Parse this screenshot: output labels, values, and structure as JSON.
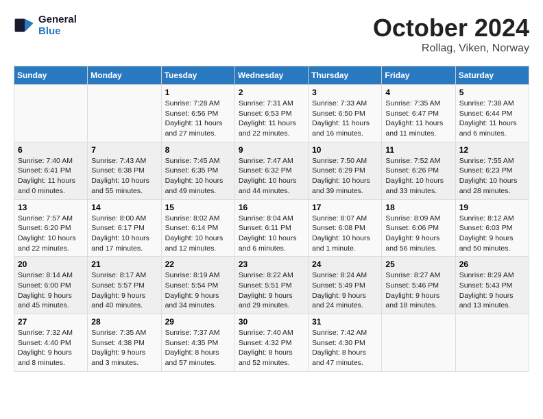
{
  "header": {
    "logo_line1": "General",
    "logo_line2": "Blue",
    "title": "October 2024",
    "subtitle": "Rollag, Viken, Norway"
  },
  "columns": [
    "Sunday",
    "Monday",
    "Tuesday",
    "Wednesday",
    "Thursday",
    "Friday",
    "Saturday"
  ],
  "weeks": [
    [
      {
        "day": "",
        "info": ""
      },
      {
        "day": "",
        "info": ""
      },
      {
        "day": "1",
        "info": "Sunrise: 7:28 AM\nSunset: 6:56 PM\nDaylight: 11 hours\nand 27 minutes."
      },
      {
        "day": "2",
        "info": "Sunrise: 7:31 AM\nSunset: 6:53 PM\nDaylight: 11 hours\nand 22 minutes."
      },
      {
        "day": "3",
        "info": "Sunrise: 7:33 AM\nSunset: 6:50 PM\nDaylight: 11 hours\nand 16 minutes."
      },
      {
        "day": "4",
        "info": "Sunrise: 7:35 AM\nSunset: 6:47 PM\nDaylight: 11 hours\nand 11 minutes."
      },
      {
        "day": "5",
        "info": "Sunrise: 7:38 AM\nSunset: 6:44 PM\nDaylight: 11 hours\nand 6 minutes."
      }
    ],
    [
      {
        "day": "6",
        "info": "Sunrise: 7:40 AM\nSunset: 6:41 PM\nDaylight: 11 hours\nand 0 minutes."
      },
      {
        "day": "7",
        "info": "Sunrise: 7:43 AM\nSunset: 6:38 PM\nDaylight: 10 hours\nand 55 minutes."
      },
      {
        "day": "8",
        "info": "Sunrise: 7:45 AM\nSunset: 6:35 PM\nDaylight: 10 hours\nand 49 minutes."
      },
      {
        "day": "9",
        "info": "Sunrise: 7:47 AM\nSunset: 6:32 PM\nDaylight: 10 hours\nand 44 minutes."
      },
      {
        "day": "10",
        "info": "Sunrise: 7:50 AM\nSunset: 6:29 PM\nDaylight: 10 hours\nand 39 minutes."
      },
      {
        "day": "11",
        "info": "Sunrise: 7:52 AM\nSunset: 6:26 PM\nDaylight: 10 hours\nand 33 minutes."
      },
      {
        "day": "12",
        "info": "Sunrise: 7:55 AM\nSunset: 6:23 PM\nDaylight: 10 hours\nand 28 minutes."
      }
    ],
    [
      {
        "day": "13",
        "info": "Sunrise: 7:57 AM\nSunset: 6:20 PM\nDaylight: 10 hours\nand 22 minutes."
      },
      {
        "day": "14",
        "info": "Sunrise: 8:00 AM\nSunset: 6:17 PM\nDaylight: 10 hours\nand 17 minutes."
      },
      {
        "day": "15",
        "info": "Sunrise: 8:02 AM\nSunset: 6:14 PM\nDaylight: 10 hours\nand 12 minutes."
      },
      {
        "day": "16",
        "info": "Sunrise: 8:04 AM\nSunset: 6:11 PM\nDaylight: 10 hours\nand 6 minutes."
      },
      {
        "day": "17",
        "info": "Sunrise: 8:07 AM\nSunset: 6:08 PM\nDaylight: 10 hours\nand 1 minute."
      },
      {
        "day": "18",
        "info": "Sunrise: 8:09 AM\nSunset: 6:06 PM\nDaylight: 9 hours\nand 56 minutes."
      },
      {
        "day": "19",
        "info": "Sunrise: 8:12 AM\nSunset: 6:03 PM\nDaylight: 9 hours\nand 50 minutes."
      }
    ],
    [
      {
        "day": "20",
        "info": "Sunrise: 8:14 AM\nSunset: 6:00 PM\nDaylight: 9 hours\nand 45 minutes."
      },
      {
        "day": "21",
        "info": "Sunrise: 8:17 AM\nSunset: 5:57 PM\nDaylight: 9 hours\nand 40 minutes."
      },
      {
        "day": "22",
        "info": "Sunrise: 8:19 AM\nSunset: 5:54 PM\nDaylight: 9 hours\nand 34 minutes."
      },
      {
        "day": "23",
        "info": "Sunrise: 8:22 AM\nSunset: 5:51 PM\nDaylight: 9 hours\nand 29 minutes."
      },
      {
        "day": "24",
        "info": "Sunrise: 8:24 AM\nSunset: 5:49 PM\nDaylight: 9 hours\nand 24 minutes."
      },
      {
        "day": "25",
        "info": "Sunrise: 8:27 AM\nSunset: 5:46 PM\nDaylight: 9 hours\nand 18 minutes."
      },
      {
        "day": "26",
        "info": "Sunrise: 8:29 AM\nSunset: 5:43 PM\nDaylight: 9 hours\nand 13 minutes."
      }
    ],
    [
      {
        "day": "27",
        "info": "Sunrise: 7:32 AM\nSunset: 4:40 PM\nDaylight: 9 hours\nand 8 minutes."
      },
      {
        "day": "28",
        "info": "Sunrise: 7:35 AM\nSunset: 4:38 PM\nDaylight: 9 hours\nand 3 minutes."
      },
      {
        "day": "29",
        "info": "Sunrise: 7:37 AM\nSunset: 4:35 PM\nDaylight: 8 hours\nand 57 minutes."
      },
      {
        "day": "30",
        "info": "Sunrise: 7:40 AM\nSunset: 4:32 PM\nDaylight: 8 hours\nand 52 minutes."
      },
      {
        "day": "31",
        "info": "Sunrise: 7:42 AM\nSunset: 4:30 PM\nDaylight: 8 hours\nand 47 minutes."
      },
      {
        "day": "",
        "info": ""
      },
      {
        "day": "",
        "info": ""
      }
    ]
  ]
}
